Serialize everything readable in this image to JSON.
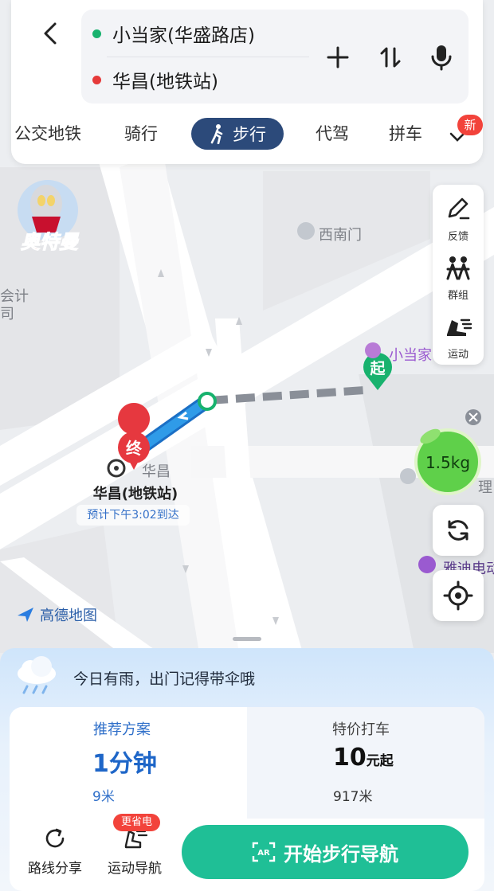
{
  "header": {
    "origin": "小当家(华盛路店)",
    "destination": "华昌(地铁站)",
    "origin_color": "#18b26e",
    "destination_color": "#e63a3a"
  },
  "tabs": [
    {
      "label": "公交地铁"
    },
    {
      "label": "骑行"
    },
    {
      "label": "步行",
      "active": true
    },
    {
      "label": "代驾"
    },
    {
      "label": "拼车"
    }
  ],
  "tabs_more_badge": "新",
  "side_panel": {
    "feedback": "反馈",
    "group": "群组",
    "sport": "运动"
  },
  "map": {
    "poi_southwest_gate": "西南门",
    "poi_xiaodangjia": "小当家",
    "poi_huachang": "华昌",
    "poi_yadi": "雅迪电动",
    "left_edge_text_1": "会计",
    "left_edge_text_2": "司",
    "right_edge_text": "理",
    "start_marker": "起",
    "end_marker": "终",
    "destination_name": "华昌(地铁站)",
    "eta": "预计下午3:02到达",
    "carbon_value": "1.5kg",
    "map_logo": "高德地图",
    "sticker_text": "奥特曼"
  },
  "bottom": {
    "weather_tip": "今日有雨，出门记得带伞哦",
    "plan_recommended": {
      "title": "推荐方案",
      "duration": "1分钟",
      "distance": "9米"
    },
    "plan_taxi": {
      "title": "特价打车",
      "price": "10",
      "price_suffix": "元起",
      "distance": "917米"
    },
    "share_label": "路线分享",
    "sport_nav_label": "运动导航",
    "save_badge": "更省电",
    "start_button": "开始步行导航"
  },
  "colors": {
    "route_blue": "#2f9be8",
    "accent_green": "#1fbf96",
    "tab_active_bg": "#2c4a7a",
    "badge_red": "#f2433b"
  }
}
